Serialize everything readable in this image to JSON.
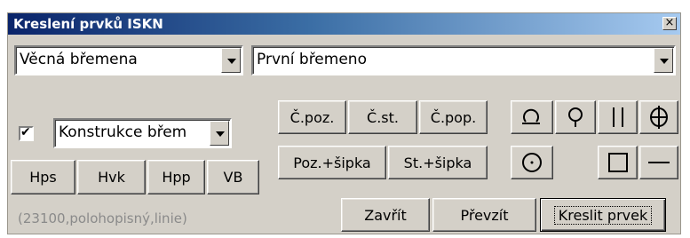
{
  "window": {
    "title": "Kreslení prvků ISKN",
    "close_label": "×"
  },
  "selectors": {
    "category": "Věcná břemena",
    "item": "První břemeno",
    "layer": "Konstrukce břem"
  },
  "layer_checkbox": {
    "checked": true,
    "mark": "✔"
  },
  "layer_buttons": [
    "Hps",
    "Hvk",
    "Hpp",
    "VB"
  ],
  "text_buttons": {
    "c_poz": "Č.poz.",
    "c_st": "Č.st.",
    "c_pop": "Č.pop.",
    "poz_sipka": "Poz.+šipka",
    "st_sipka": "St.+šipka"
  },
  "status_text": "(23100,polohopisný,linie)",
  "actions": {
    "close": "Zavřít",
    "take": "Převzít",
    "draw": "Kreslit prvek"
  }
}
